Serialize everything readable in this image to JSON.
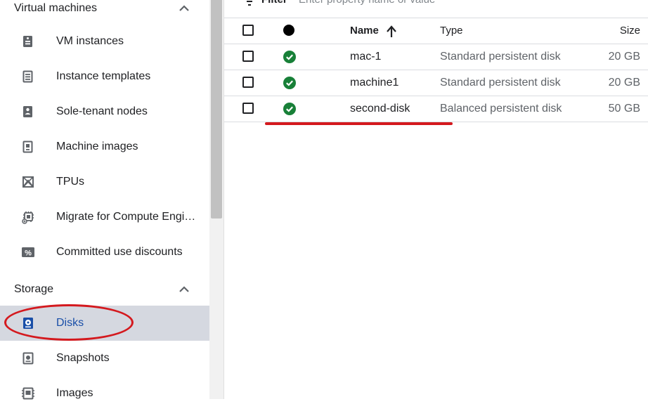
{
  "sidebar": {
    "sections": [
      {
        "label": "Virtual machines"
      },
      {
        "label": "Storage"
      }
    ],
    "items": [
      {
        "label": "VM instances",
        "icon": "vm-instance-icon"
      },
      {
        "label": "Instance templates",
        "icon": "instance-template-icon"
      },
      {
        "label": "Sole-tenant nodes",
        "icon": "sole-tenant-icon"
      },
      {
        "label": "Machine images",
        "icon": "machine-image-icon"
      },
      {
        "label": "TPUs",
        "icon": "tpu-icon"
      },
      {
        "label": "Migrate for Compute Engi…",
        "icon": "migrate-icon"
      },
      {
        "label": "Committed use discounts",
        "icon": "percent-icon"
      },
      {
        "label": "Disks",
        "icon": "disk-icon",
        "active": true
      },
      {
        "label": "Snapshots",
        "icon": "snapshot-icon"
      },
      {
        "label": "Images",
        "icon": "image-icon"
      }
    ]
  },
  "filter": {
    "label": "Filter",
    "placeholder": "Enter property name or value"
  },
  "table": {
    "headers": {
      "name": "Name",
      "type": "Type",
      "size": "Size"
    },
    "rows": [
      {
        "name": "mac-1",
        "type": "Standard persistent disk",
        "size": "20 GB",
        "status": "ok"
      },
      {
        "name": "machine1",
        "type": "Standard persistent disk",
        "size": "20 GB",
        "status": "ok"
      },
      {
        "name": "second-disk",
        "type": "Balanced persistent disk",
        "size": "50 GB",
        "status": "ok"
      }
    ]
  },
  "colors": {
    "accent": "#1a4fa8",
    "highlight": "#d4191e",
    "ok": "#188038",
    "active_bg": "#d5d8e0"
  }
}
